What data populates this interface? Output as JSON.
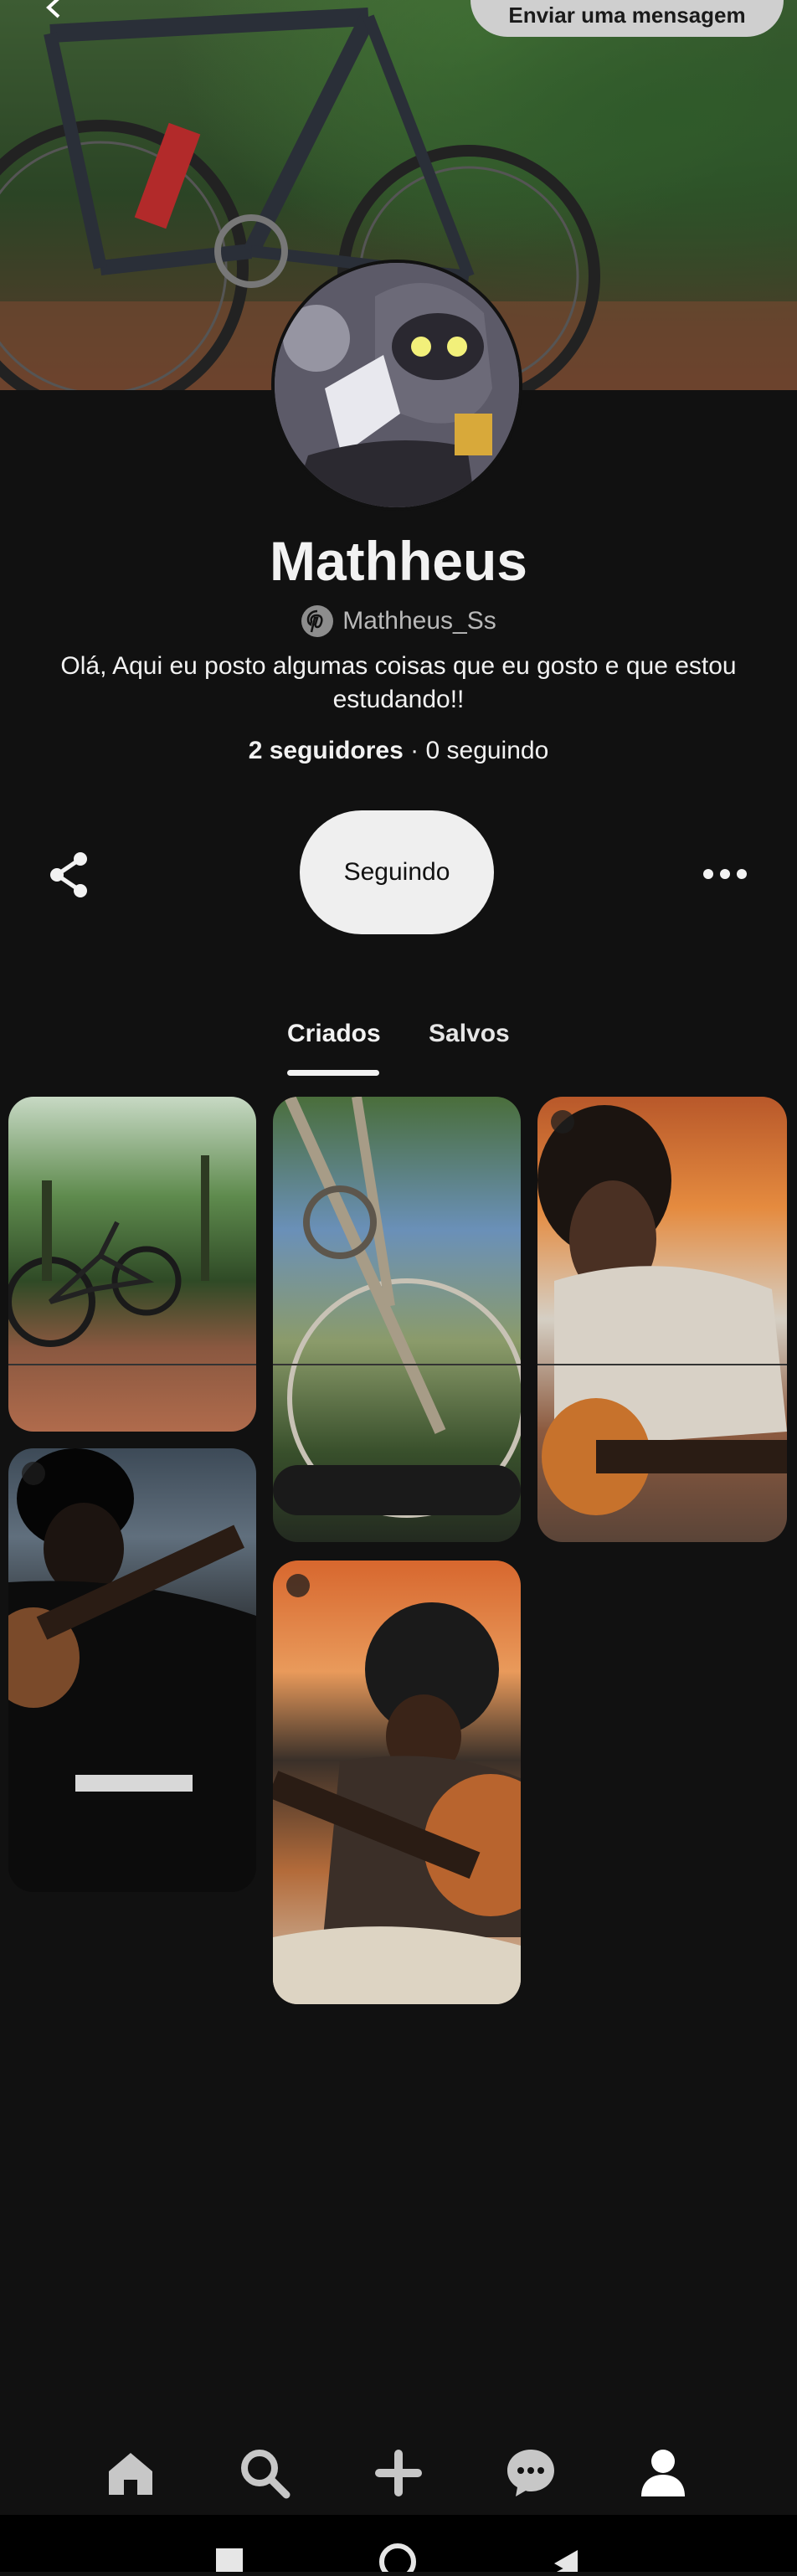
{
  "header": {
    "message_button_label": "Enviar uma mensagem"
  },
  "profile": {
    "name": "Mathheus",
    "handle": "Mathheus_Ss",
    "bio": "Olá, Aqui eu posto algumas coisas que eu gosto e que estou estudando!!",
    "followers": "2 seguidores",
    "separator": "·",
    "following": "0 seguindo"
  },
  "actions": {
    "follow_label": "Seguindo"
  },
  "tabs": [
    {
      "label": "Criados",
      "selected": true
    },
    {
      "label": "Salvos",
      "selected": false
    }
  ],
  "pins": [
    {
      "icon": "bicycle-photo"
    },
    {
      "icon": "bicycle-wheel-photo"
    },
    {
      "icon": "guitar-player-photo"
    },
    {
      "icon": "guitar-player-dark-photo"
    },
    {
      "icon": "guitar-player-orange-photo"
    }
  ],
  "bottom_nav": [
    {
      "icon": "home-icon"
    },
    {
      "icon": "search-icon"
    },
    {
      "icon": "plus-icon"
    },
    {
      "icon": "chat-icon"
    },
    {
      "icon": "profile-icon",
      "active": true
    }
  ],
  "colors": {
    "background": "#111111",
    "text": "#f2f2f2",
    "button": "#efefef"
  }
}
